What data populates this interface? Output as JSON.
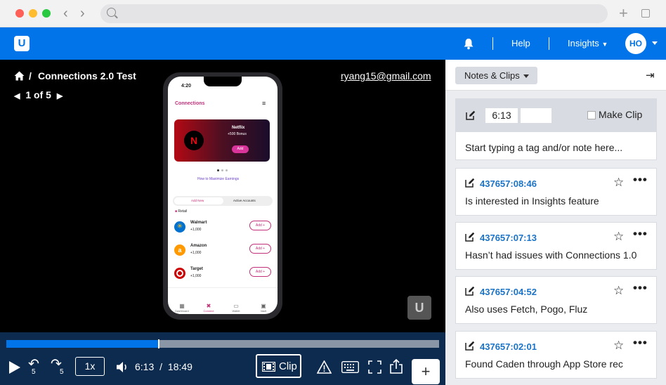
{
  "header": {
    "help_label": "Help",
    "insights_label": "Insights",
    "avatar_initials": "HO",
    "brand_color": "#0074e8"
  },
  "video": {
    "title": "Connections 2.0 Test",
    "breadcrumb_sep": "/",
    "pager": "1 of 5",
    "email": "ryang15@gmail.com"
  },
  "phone": {
    "time": "4:20",
    "app_title": "Connections",
    "promo_name": "Netflix",
    "promo_bonus": "+500 Bonus",
    "promo_add": "Add",
    "earnings_link": "How to Maximize Earnings",
    "tabs": [
      "Add New",
      "Active Accounts"
    ],
    "section": "Retail",
    "merchants": [
      {
        "name": "Walmart",
        "points": "+1,000",
        "add": "Add +"
      },
      {
        "name": "Amazon",
        "points": "+1,000",
        "add": "Add +"
      },
      {
        "name": "Target",
        "points": "+1,000",
        "add": "Add +"
      }
    ],
    "nav": [
      "Dashboard",
      "Connect",
      "Wallet",
      "Vault"
    ]
  },
  "player": {
    "progress": 0.35,
    "skip_back": "5",
    "skip_forward": "5",
    "speed": "1x",
    "current_time": "6:13",
    "time_sep": "/",
    "duration": "18:49",
    "clip_label": "Clip",
    "add_label": "+"
  },
  "sidebar": {
    "dropdown_label": "Notes & Clips",
    "composer": {
      "time": "6:13",
      "make_clip_label": "Make Clip",
      "placeholder": "Start typing a tag and/or note here..."
    },
    "notes": [
      {
        "timestamp": "437657:08:46",
        "text": "Is interested in Insights feature"
      },
      {
        "timestamp": "437657:07:13",
        "text": "Hasn’t had issues with Connections 1.0"
      },
      {
        "timestamp": "437657:04:52",
        "text": "Also uses Fetch, Pogo, Fluz"
      },
      {
        "timestamp": "437657:02:01",
        "text": "Found Caden through App Store rec"
      }
    ],
    "more_label": "•••"
  }
}
